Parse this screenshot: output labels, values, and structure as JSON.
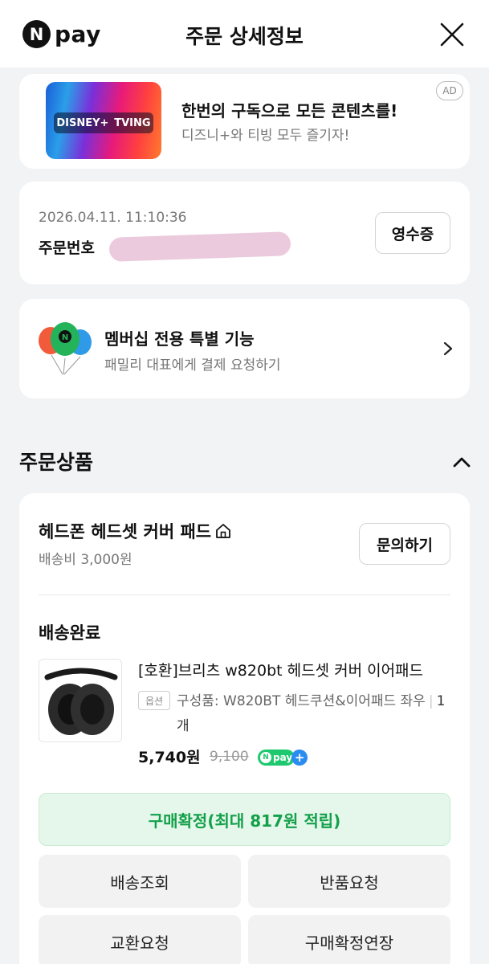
{
  "header": {
    "logo_n": "N",
    "logo_pay": "pay",
    "title": "주문 상세정보"
  },
  "ad": {
    "thumb_left": "DISNEY+",
    "thumb_right": "TVING",
    "title": "한번의 구독으로 모든 콘텐츠를!",
    "subtitle": "디즈니+와 티빙 모두 즐기자!",
    "badge": "AD"
  },
  "order": {
    "datetime": "2026.04.11. 11:10:36",
    "number_label": "주문번호",
    "receipt_label": "영수증"
  },
  "membership": {
    "title": "멤버십 전용 특별 기능",
    "subtitle": "패밀리 대표에게 결제 요청하기"
  },
  "section": {
    "title": "주문상품"
  },
  "product": {
    "shop_name": "헤드폰 헤드셋 커버 패드",
    "shipping_fee": "배송비 3,000원",
    "inquiry_label": "문의하기",
    "status": "배송완료",
    "name": "[호환]브리츠 w820bt 헤드셋 커버 이어패드",
    "option_badge": "옵션",
    "option_text": "구성품: W820BT 헤드쿠션&이어패드 좌우",
    "quantity": "1개",
    "price": "5,740원",
    "original_price": "9,100",
    "npay_badge": "pay"
  },
  "actions": {
    "confirm_label": "구매확정(최대 817원 적립)",
    "track_label": "배송조회",
    "return_label": "반품요청",
    "exchange_label": "교환요청",
    "extend_label": "구매확정연장"
  },
  "colors": {
    "accent_green": "#13a04a",
    "npay_green": "#1ec86e",
    "background": "#f2f3f5"
  }
}
